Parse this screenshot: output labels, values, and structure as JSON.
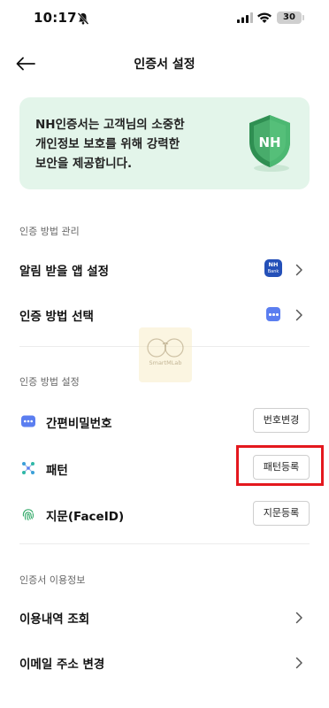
{
  "status_bar": {
    "time": "10:17",
    "battery": "30"
  },
  "header": {
    "title": "인증서 설정"
  },
  "banner": {
    "line1": "NH인증서는 고객님의 소중한",
    "line2": "개인정보 보호를 위해 강력한",
    "line3": "보안을 제공합니다.",
    "shield_label": "NH"
  },
  "auth_management": {
    "section_title": "인증 방법 관리",
    "items": [
      {
        "label": "알림 받을 앱 설정",
        "icon": "nh-bank-app-icon"
      },
      {
        "label": "인증 방법 선택",
        "icon": "method-dots-icon"
      }
    ],
    "nh_icon_text": {
      "top": "NH",
      "bottom": "Bank"
    }
  },
  "auth_settings": {
    "section_title": "인증 방법 설정",
    "items": [
      {
        "label": "간편비밀번호",
        "button": "번호변경",
        "icon": "pin-dots-icon"
      },
      {
        "label": "패턴",
        "button": "패턴등록",
        "icon": "pattern-icon"
      },
      {
        "label": "지문(FaceID)",
        "button": "지문등록",
        "icon": "fingerprint-icon"
      }
    ]
  },
  "cert_info": {
    "section_title": "인증서 이용정보",
    "items": [
      {
        "label": "이용내역 조회"
      },
      {
        "label": "이메일 주소 변경"
      }
    ]
  },
  "watermark": {
    "text": "SmartMLab"
  },
  "colors": {
    "banner_bg": "#e3f5ea",
    "shield_green": "#3aa45f",
    "highlight_red": "#e4181e",
    "method_blue": "#5b7ef0",
    "nh_blue": "#2450b8"
  }
}
